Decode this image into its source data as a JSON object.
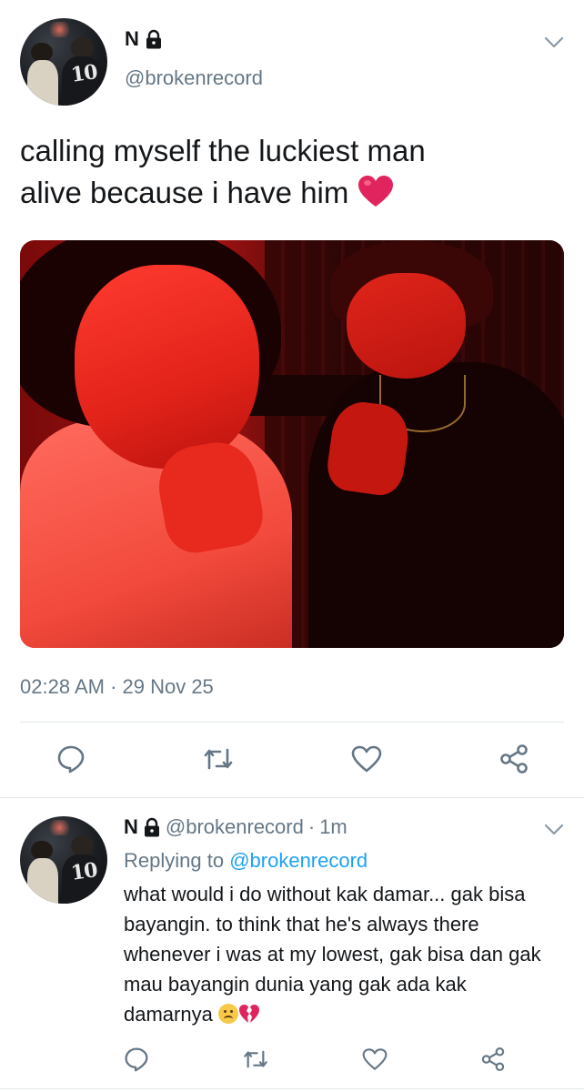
{
  "tweet": {
    "author_name": "N",
    "author_handle": "@brokenrecord",
    "text_line1": "calling myself the luckiest man",
    "text_line2": "alive because i have him",
    "heart_emoji": "❤️",
    "timestamp": "02:28 AM · 29 Nov 25",
    "icons": {
      "lock": "lock-icon",
      "menu": "chevron-down-icon",
      "reply": "reply-icon",
      "retweet": "retweet-icon",
      "like": "like-icon",
      "share": "share-icon"
    }
  },
  "reply": {
    "author_name": "N",
    "author_handle": "@brokenrecord",
    "separator": "·",
    "time": "1m",
    "replying_prefix": "Replying to",
    "replying_to": "@brokenrecord",
    "text": "what would i do without kak damar... gak bisa bayangin. to think that he's always there whenever i was at my lowest, gak bisa dan gak mau bayangin dunia yang gak ada kak damarnya",
    "emojis": [
      "frowning-face-emoji",
      "broken-heart-emoji"
    ]
  },
  "colors": {
    "text_primary": "#14171a",
    "text_secondary": "#657786",
    "link": "#1da1f2",
    "divider": "#e1e8ed",
    "heart": "#e0245e"
  }
}
